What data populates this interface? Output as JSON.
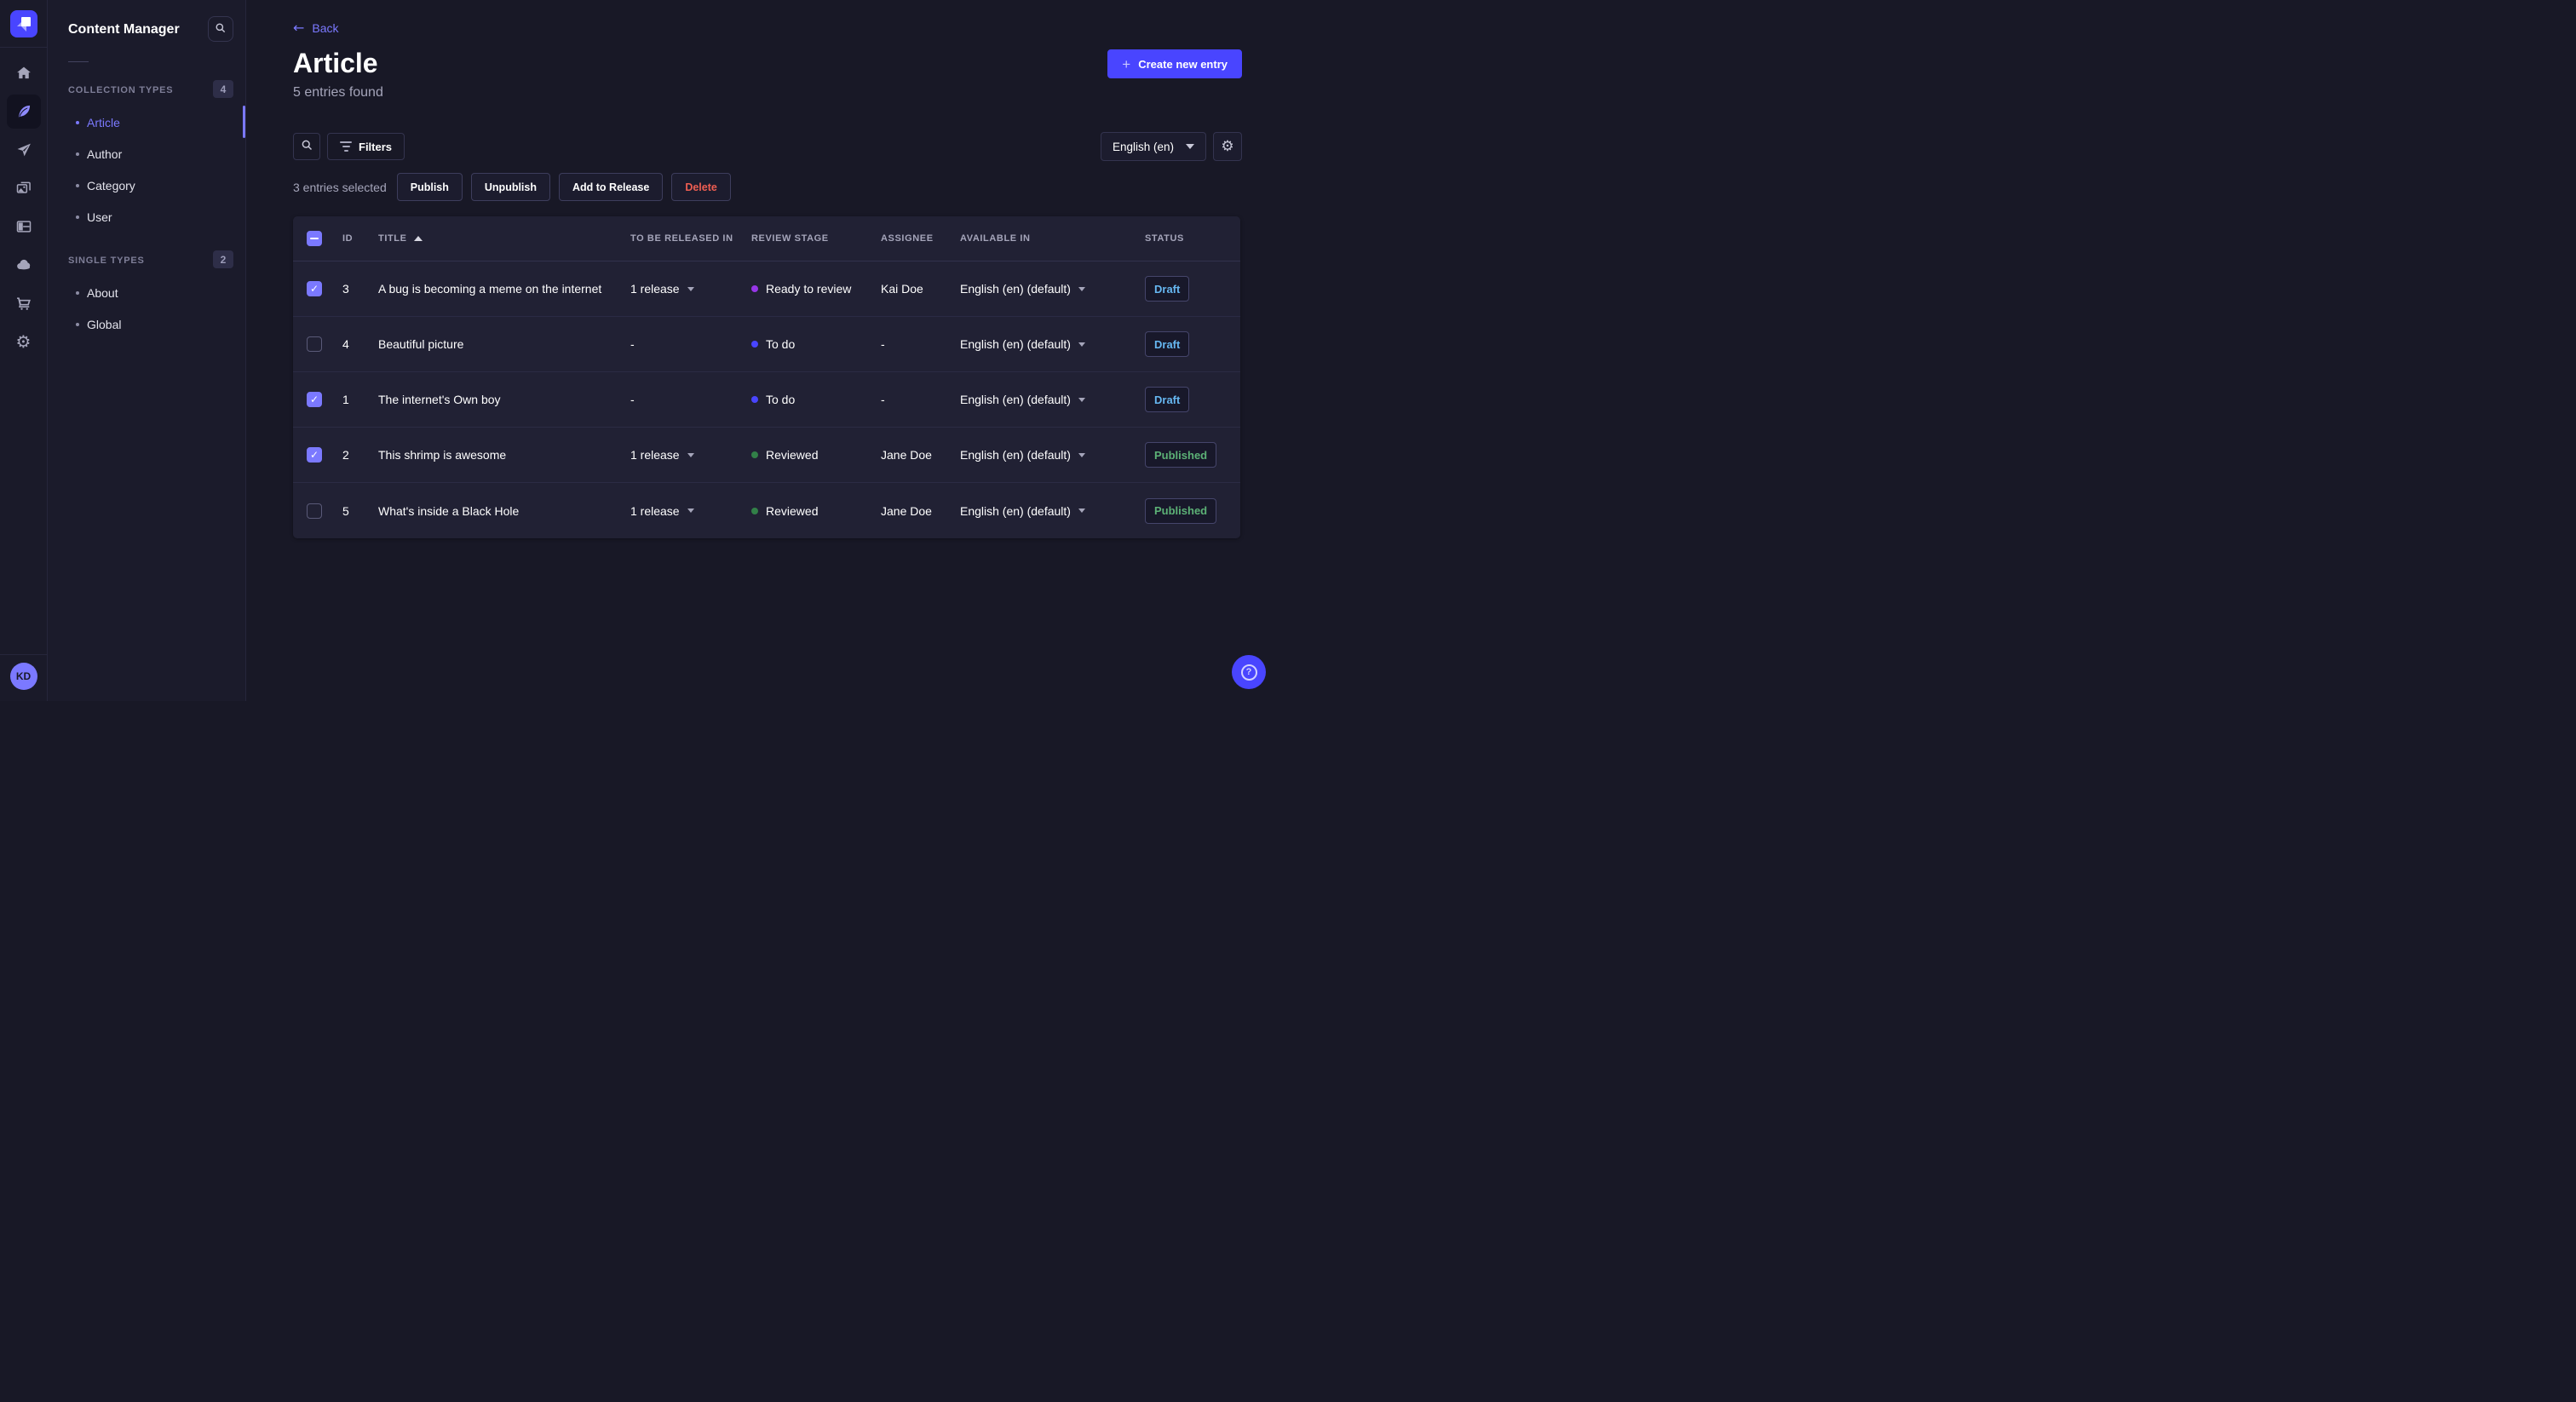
{
  "nav_rail": {
    "logo": "strapi-logo",
    "items": [
      "home",
      "content-manager",
      "releases",
      "media-library",
      "content-type-builder",
      "cloud",
      "marketplace",
      "settings"
    ],
    "active_item": "content-manager",
    "avatar_initials": "KD"
  },
  "subnav": {
    "title": "Content Manager",
    "sections": [
      {
        "label": "COLLECTION TYPES",
        "badge": "4",
        "items": [
          {
            "label": "Article",
            "active": true
          },
          {
            "label": "Author"
          },
          {
            "label": "Category"
          },
          {
            "label": "User"
          }
        ]
      },
      {
        "label": "SINGLE TYPES",
        "badge": "2",
        "items": [
          {
            "label": "About"
          },
          {
            "label": "Global"
          }
        ]
      }
    ]
  },
  "header": {
    "back_label": "Back",
    "title": "Article",
    "subtitle": "5 entries found",
    "create_button_label": "Create new entry"
  },
  "toolbar": {
    "filters_label": "Filters",
    "locale_value": "English (en)"
  },
  "selection_bar": {
    "selected_text": "3 entries selected",
    "publish_label": "Publish",
    "unpublish_label": "Unpublish",
    "add_to_release_label": "Add to Release",
    "delete_label": "Delete"
  },
  "table": {
    "columns": {
      "id": "ID",
      "title": "TITLE",
      "release": "TO BE RELEASED IN",
      "stage": "REVIEW STAGE",
      "assignee": "ASSIGNEE",
      "available": "AVAILABLE IN",
      "status": "STATUS"
    },
    "header_checkbox_state": "indeterminate",
    "sort": {
      "column": "TITLE",
      "direction": "asc"
    },
    "rows": [
      {
        "checked": true,
        "id": "3",
        "title": "A bug is becoming a meme on the internet",
        "release": "1 release",
        "stage": "Ready to review",
        "stage_color": "#9736e8",
        "assignee": "Kai Doe",
        "available": "English (en) (default)",
        "status": "Draft"
      },
      {
        "checked": false,
        "id": "4",
        "title": "Beautiful picture",
        "release": "-",
        "stage": "To do",
        "stage_color": "#4945ff",
        "assignee": "-",
        "available": "English (en) (default)",
        "status": "Draft"
      },
      {
        "checked": true,
        "id": "1",
        "title": "The internet's Own boy",
        "release": "-",
        "stage": "To do",
        "stage_color": "#4945ff",
        "assignee": "-",
        "available": "English (en) (default)",
        "status": "Draft"
      },
      {
        "checked": true,
        "id": "2",
        "title": "This shrimp is awesome",
        "release": "1 release",
        "stage": "Reviewed",
        "stage_color": "#328048",
        "assignee": "Jane Doe",
        "available": "English (en) (default)",
        "status": "Published"
      },
      {
        "checked": false,
        "id": "5",
        "title": "What's inside a Black Hole",
        "release": "1 release",
        "stage": "Reviewed",
        "stage_color": "#328048",
        "assignee": "Jane Doe",
        "available": "English (en) (default)",
        "status": "Published"
      }
    ]
  },
  "colors": {
    "accent": "#4945ff",
    "accent_light": "#7b79ff",
    "danger": "#ee5e52",
    "draft": "#66b7f1",
    "published": "#5cb176",
    "stage_todo": "#4945ff",
    "stage_ready": "#9736e8",
    "stage_reviewed": "#328048"
  }
}
